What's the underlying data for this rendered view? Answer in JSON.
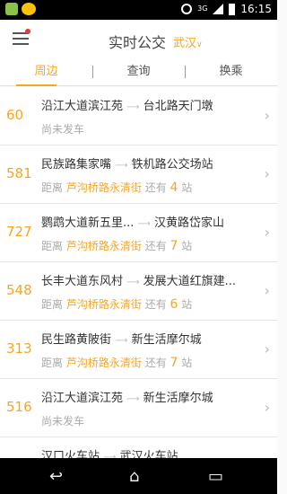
{
  "status_bar": {
    "time": "16:15",
    "network": "3G"
  },
  "header": {
    "title": "实时公交",
    "city": "武汉"
  },
  "tabs": [
    {
      "label": "周边"
    },
    {
      "label": "查询"
    },
    {
      "label": "换乘"
    }
  ],
  "rows": [
    {
      "line": "60",
      "from": "沿江大道滨江苑",
      "to": "台北路天门墩",
      "status": "尚未发车"
    },
    {
      "line": "581",
      "from": "民族路集家嘴",
      "to": "铁机路公交场站",
      "dist_label": "距离",
      "stop": "芦沟桥路永清街",
      "remain_pre": "还有",
      "count": "4",
      "remain_post": "站"
    },
    {
      "line": "727",
      "from": "鹦鹉大道新五里...",
      "to": "汉黄路岱家山",
      "dist_label": "距离",
      "stop": "芦沟桥路永清街",
      "remain_pre": "还有",
      "count": "7",
      "remain_post": "站"
    },
    {
      "line": "548",
      "from": "长丰大道东风村",
      "to": "发展大道红旗建...",
      "dist_label": "距离",
      "stop": "芦沟桥路永清街",
      "remain_pre": "还有",
      "count": "6",
      "remain_post": "站"
    },
    {
      "line": "313",
      "from": "民生路黄陂街",
      "to": "新生活摩尔城",
      "dist_label": "距离",
      "stop": "芦沟桥路永清街",
      "remain_pre": "还有",
      "count": "7",
      "remain_post": "站"
    },
    {
      "line": "516",
      "from": "沿江大道滨江苑",
      "to": "新生活摩尔城",
      "status": "尚未发车"
    },
    {
      "line": "",
      "from": "汉口火车站",
      "to": "武汉火车站",
      "status": ""
    }
  ]
}
